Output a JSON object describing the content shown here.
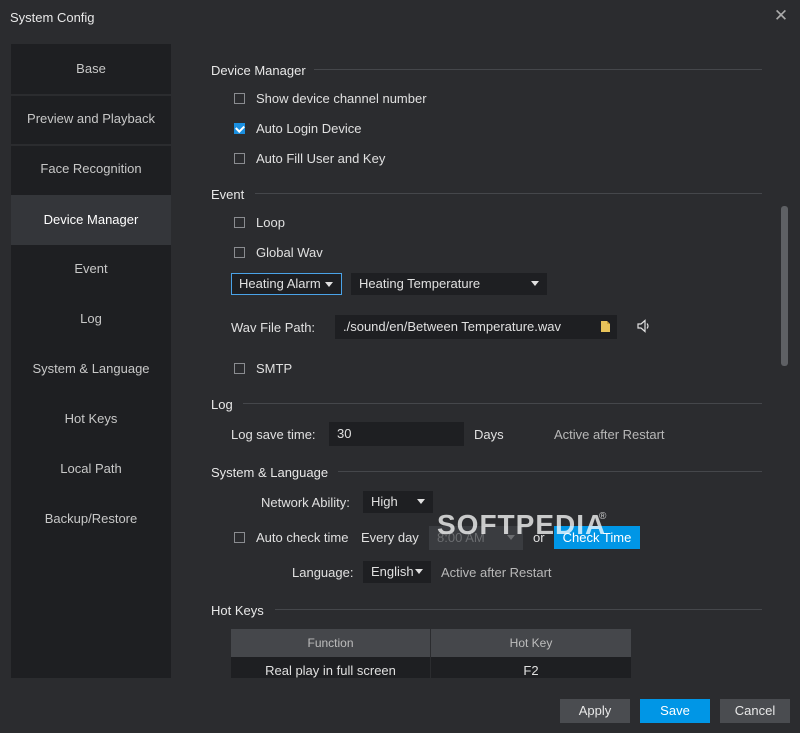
{
  "window": {
    "title": "System Config",
    "close_glyph": "✕"
  },
  "sidebar": {
    "items": [
      {
        "label": "Base"
      },
      {
        "label": "Preview and Playback"
      },
      {
        "label": "Face Recognition"
      },
      {
        "label": "Device Manager"
      },
      {
        "label": "Event"
      },
      {
        "label": "Log"
      },
      {
        "label": "System & Language"
      },
      {
        "label": "Hot Keys"
      },
      {
        "label": "Local Path"
      },
      {
        "label": "Backup/Restore"
      }
    ],
    "active": "Device Manager"
  },
  "device_manager": {
    "title": "Device Manager",
    "show_channel_number": {
      "label": "Show device channel number",
      "checked": false
    },
    "auto_login": {
      "label": "Auto Login Device",
      "checked": true
    },
    "auto_fill": {
      "label": "Auto Fill User and Key",
      "checked": false
    }
  },
  "event": {
    "title": "Event",
    "loop": {
      "label": "Loop",
      "checked": false
    },
    "global_wav": {
      "label": "Global Wav",
      "checked": false
    },
    "alarm_type": "Heating Alarm",
    "alarm_subtype": "Heating Temperature",
    "wav_path_label": "Wav File Path:",
    "wav_path_value": "./sound/en/Between Temperature.wav",
    "smtp": {
      "label": "SMTP",
      "checked": false
    }
  },
  "log": {
    "title": "Log",
    "save_time_label": "Log save time:",
    "save_time_value": "30",
    "unit": "Days",
    "note": "Active after Restart"
  },
  "system_language": {
    "title": "System & Language",
    "network_label": "Network Ability:",
    "network_value": "High",
    "auto_check": {
      "label": "Auto check time",
      "checked": false
    },
    "every_day": "Every day",
    "time_value": "8:00 AM",
    "or": "or",
    "check_time_button": "Check Time",
    "language_label": "Language:",
    "language_value": "English",
    "note": "Active after Restart"
  },
  "hot_keys": {
    "title": "Hot Keys",
    "columns": [
      "Function",
      "Hot Key"
    ],
    "rows": [
      {
        "function": "Real play in full screen",
        "key": "F2"
      }
    ]
  },
  "footer": {
    "apply": "Apply",
    "save": "Save",
    "cancel": "Cancel"
  },
  "watermark": {
    "text": "SOFTPEDIA",
    "reg": "®"
  },
  "colors": {
    "accent": "#0096e6",
    "background": "#2b2c2f",
    "panel": "#1e1f22"
  }
}
